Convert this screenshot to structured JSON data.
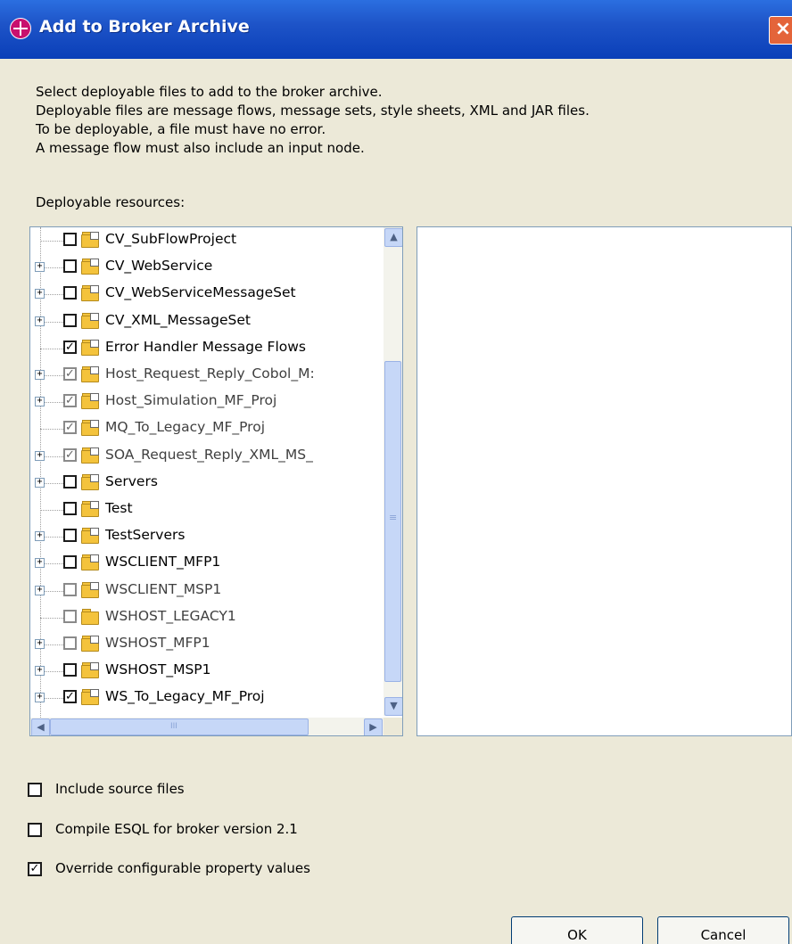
{
  "window": {
    "title": "Add to Broker Archive",
    "close_glyph": "×"
  },
  "description": [
    "Select deployable files to add to the broker archive.",
    "Deployable files are message flows, message sets, style sheets, XML and JAR files.",
    "To be deployable, a file must have no error.",
    "A message flow must also include an input node."
  ],
  "resources_label": "Deployable resources:",
  "tree": {
    "items": [
      {
        "label": "CV_SubFlowProject",
        "checked": false,
        "expandable": false,
        "icon": "message-flow-project-icon",
        "grey": false
      },
      {
        "label": "CV_WebService",
        "checked": false,
        "expandable": true,
        "icon": "message-flow-project-icon",
        "grey": false
      },
      {
        "label": "CV_WebServiceMessageSet",
        "checked": false,
        "expandable": true,
        "icon": "message-set-project-icon",
        "grey": false
      },
      {
        "label": "CV_XML_MessageSet",
        "checked": false,
        "expandable": true,
        "icon": "message-set-project-icon",
        "grey": false
      },
      {
        "label": "Error Handler Message Flows",
        "checked": true,
        "expandable": false,
        "icon": "message-flow-project-icon",
        "grey": false
      },
      {
        "label": "Host_Request_Reply_Cobol_M:",
        "checked": true,
        "expandable": true,
        "icon": "message-set-project-icon",
        "grey": true
      },
      {
        "label": "Host_Simulation_MF_Proj",
        "checked": true,
        "expandable": true,
        "icon": "message-flow-project-icon",
        "grey": true
      },
      {
        "label": "MQ_To_Legacy_MF_Proj",
        "checked": true,
        "expandable": false,
        "icon": "message-flow-project-icon",
        "grey": true
      },
      {
        "label": "SOA_Request_Reply_XML_MS_",
        "checked": true,
        "expandable": true,
        "icon": "message-set-project-icon",
        "grey": true
      },
      {
        "label": "Servers",
        "checked": false,
        "expandable": true,
        "icon": "server-project-icon",
        "grey": false
      },
      {
        "label": "Test",
        "checked": false,
        "expandable": false,
        "icon": "server-project-icon",
        "grey": false
      },
      {
        "label": "TestServers",
        "checked": false,
        "expandable": true,
        "icon": "server-project-icon",
        "grey": false
      },
      {
        "label": "WSCLIENT_MFP1",
        "checked": false,
        "expandable": true,
        "icon": "message-flow-project-icon",
        "grey": false
      },
      {
        "label": "WSCLIENT_MSP1",
        "checked": false,
        "expandable": true,
        "icon": "message-set-project-icon",
        "grey": true
      },
      {
        "label": "WSHOST_LEGACY1",
        "checked": false,
        "expandable": false,
        "icon": "folder-icon",
        "grey": true
      },
      {
        "label": "WSHOST_MFP1",
        "checked": false,
        "expandable": true,
        "icon": "message-flow-project-icon",
        "grey": true
      },
      {
        "label": "WSHOST_MSP1",
        "checked": false,
        "expandable": true,
        "icon": "message-set-project-icon",
        "grey": false
      },
      {
        "label": "WS_To_Legacy_MF_Proj",
        "checked": true,
        "expandable": true,
        "icon": "message-flow-project-icon",
        "grey": false
      }
    ]
  },
  "scroll": {
    "up": "▲",
    "down": "▼",
    "left": "◀",
    "right": "▶",
    "grip": "≡",
    "hgrip": "III"
  },
  "options": [
    {
      "label": "Include source files",
      "checked": false
    },
    {
      "label": "Compile ESQL for broker version 2.1",
      "checked": false
    },
    {
      "label": "Override configurable property values",
      "checked": true
    }
  ],
  "buttons": {
    "ok": "OK",
    "cancel": "Cancel"
  },
  "colors": {
    "title_bar": "#0a3fb8",
    "dialog_bg": "#ece9d8",
    "close_button": "#e4643a",
    "folder": "#f4c33c"
  }
}
